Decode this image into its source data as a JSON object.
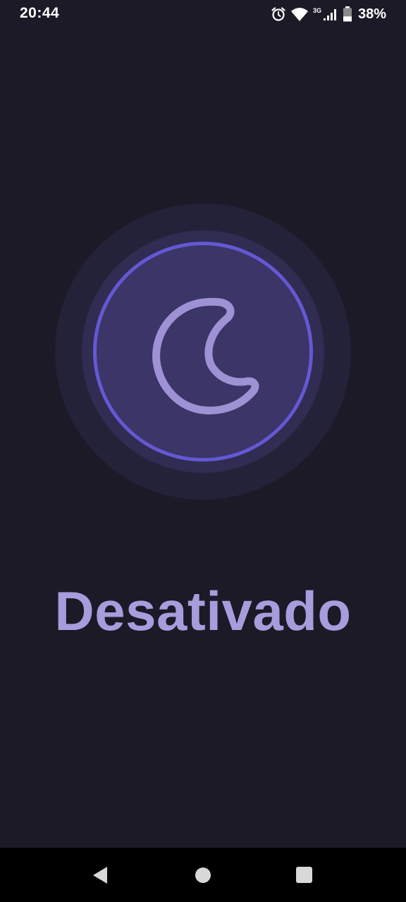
{
  "status_bar": {
    "time": "20:44",
    "network_type": "3G",
    "battery_percent": "38%",
    "battery_level": 0.38,
    "icons": [
      "alarm-icon",
      "wifi-icon",
      "signal-icon",
      "battery-icon"
    ]
  },
  "toggle": {
    "icon": "moon-icon",
    "state_label": "Desativado",
    "active": false
  },
  "colors": {
    "background": "#1c1a27",
    "ring_outer": "#242239",
    "ring_middle": "#302c52",
    "ring_inner": "#3b3568",
    "ring_border": "#6358d4",
    "accent_text": "#a69ddd",
    "nav_bar": "#000000"
  },
  "nav_bar": {
    "buttons": [
      "back-icon",
      "home-icon",
      "recents-icon"
    ]
  }
}
